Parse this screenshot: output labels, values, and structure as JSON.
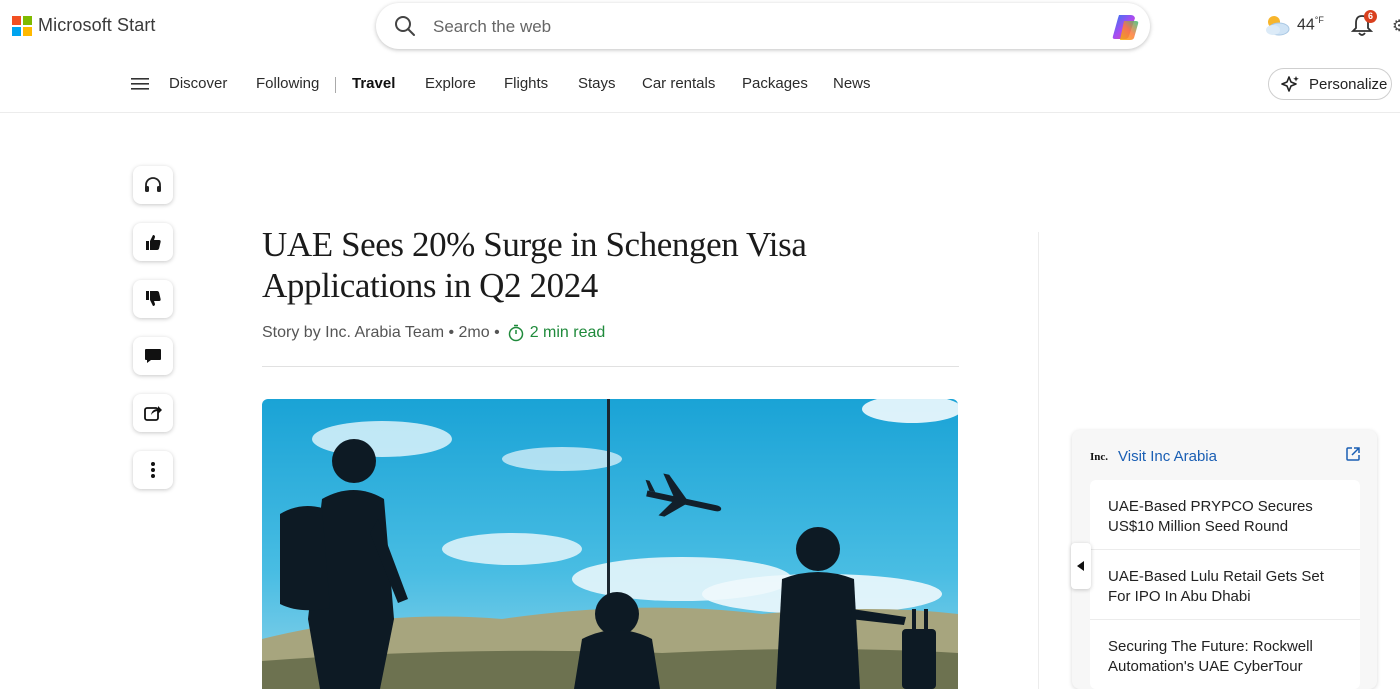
{
  "header": {
    "brand": "Microsoft Start",
    "search_placeholder": "Search the web",
    "weather_temp": "44",
    "weather_unit": "°F",
    "notification_count": "6"
  },
  "nav": {
    "items": [
      {
        "label": "Discover",
        "active": false
      },
      {
        "label": "Following",
        "active": false
      },
      {
        "label": "Travel",
        "active": true
      },
      {
        "label": "Explore",
        "active": false
      },
      {
        "label": "Flights",
        "active": false
      },
      {
        "label": "Stays",
        "active": false
      },
      {
        "label": "Car rentals",
        "active": false
      },
      {
        "label": "Packages",
        "active": false
      },
      {
        "label": "News",
        "active": false
      }
    ],
    "personalize_label": "Personalize"
  },
  "rail": [
    "headphones-icon",
    "thumbs-up-icon",
    "thumbs-down-icon",
    "comment-icon",
    "share-icon",
    "more-icon"
  ],
  "article": {
    "headline": "UAE Sees 20% Surge in Schengen Visa Applications in Q2 2024",
    "byline": "Story by Inc. Arabia Team • 2mo •",
    "read_time": "2 min read"
  },
  "sidecard": {
    "source_logo": "Inc.",
    "source_link": "Visit Inc Arabia",
    "items": [
      "UAE-Based PRYPCO Secures US$10 Million Seed Round",
      "UAE-Based Lulu Retail Gets Set For IPO In Abu Dhabi",
      "Securing The Future: Rockwell Automation's UAE CyberTour"
    ]
  },
  "colors": {
    "accent_link": "#1a5fb4",
    "read_time_green": "#1f8a3b",
    "badge_red": "#d9401e"
  }
}
